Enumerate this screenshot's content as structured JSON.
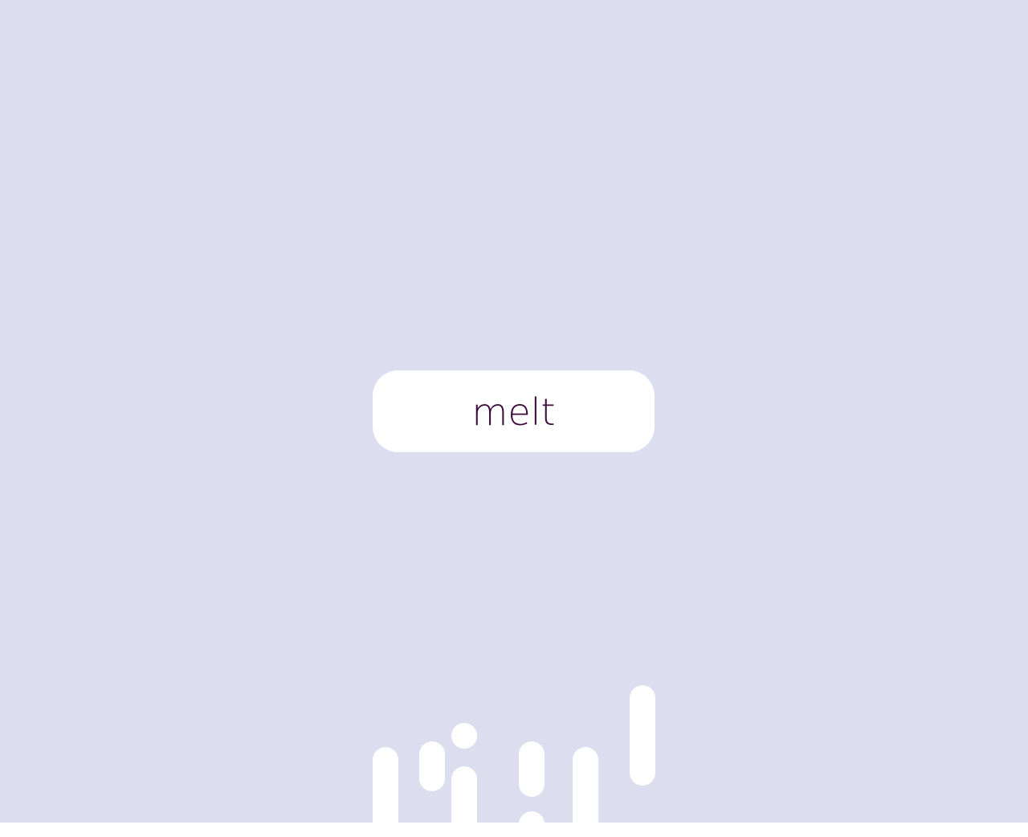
{
  "button": {
    "label": "melt"
  },
  "colors": {
    "background": "#dcddee",
    "button_fill": "#ffffff",
    "label_color": "#3c0a3a",
    "drip_color": "#ffffff"
  }
}
